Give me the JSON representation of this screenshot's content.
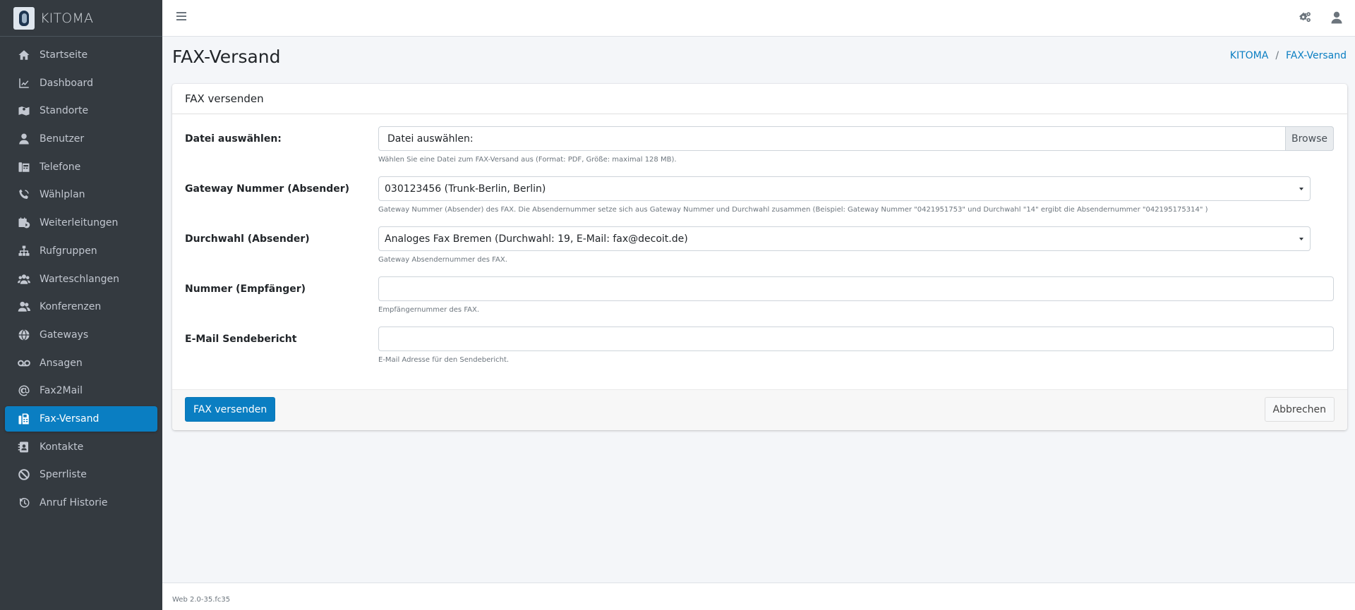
{
  "brand": {
    "name": "KITOMA"
  },
  "sidebar": {
    "items": [
      {
        "label": "Startseite",
        "icon": "home-icon",
        "active": false
      },
      {
        "label": "Dashboard",
        "icon": "chart-line-icon",
        "active": false
      },
      {
        "label": "Standorte",
        "icon": "map-location-icon",
        "active": false
      },
      {
        "label": "Benutzer",
        "icon": "user-icon",
        "active": false
      },
      {
        "label": "Telefone",
        "icon": "fax-phone-icon",
        "active": false
      },
      {
        "label": "Wählplan",
        "icon": "phone-volume-icon",
        "active": false
      },
      {
        "label": "Weiterleitungen",
        "icon": "calendar-forward-icon",
        "active": false
      },
      {
        "label": "Rufgruppen",
        "icon": "sitemap-icon",
        "active": false
      },
      {
        "label": "Warteschlangen",
        "icon": "users-queue-icon",
        "active": false
      },
      {
        "label": "Konferenzen",
        "icon": "user-group-icon",
        "active": false
      },
      {
        "label": "Gateways",
        "icon": "globe-icon",
        "active": false
      },
      {
        "label": "Ansagen",
        "icon": "voicemail-icon",
        "active": false
      },
      {
        "label": "Fax2Mail",
        "icon": "at-icon",
        "active": false
      },
      {
        "label": "Fax-Versand",
        "icon": "fax-icon",
        "active": true
      },
      {
        "label": "Kontakte",
        "icon": "address-book-icon",
        "active": false
      },
      {
        "label": "Sperrliste",
        "icon": "ban-icon",
        "active": false
      },
      {
        "label": "Anruf Historie",
        "icon": "history-icon",
        "active": false
      }
    ]
  },
  "header": {
    "title": "FAX-Versand",
    "breadcrumb": [
      "KITOMA",
      "FAX-Versand"
    ],
    "separator": "/"
  },
  "card": {
    "title": "FAX versenden",
    "fields": {
      "file": {
        "label": "Datei auswählen:",
        "placeholder": "Datei auswählen:",
        "browse": "Browse",
        "help": "Wählen Sie eine Datei zum FAX-Versand aus (Format: PDF, Größe: maximal 128 MB)."
      },
      "gateway": {
        "label": "Gateway Nummer (Absender)",
        "value": "030123456 (Trunk-Berlin, Berlin)",
        "help": "Gateway Nummer (Absender) des FAX. Die Absendernummer setze sich aus Gateway Nummer und Durchwahl zusammen (Beispiel: Gateway Nummer \"0421951753\" und Durchwahl \"14\" ergibt die Absendernummer \"042195175314\" )"
      },
      "extension": {
        "label": "Durchwahl (Absender)",
        "value": "Analoges Fax Bremen (Durchwahl: 19, E-Mail: fax@decoit.de)",
        "help": "Gateway Absendernummer des FAX."
      },
      "recipient": {
        "label": "Nummer (Empfänger)",
        "value": "",
        "help": "Empfängernummer des FAX."
      },
      "email": {
        "label": "E-Mail Sendebericht",
        "value": "",
        "help": "E-Mail Adresse für den Sendebericht."
      }
    },
    "submit": "FAX versenden",
    "cancel": "Abbrechen"
  },
  "footer": {
    "version": "Web 2.0-35.fc35"
  },
  "colors": {
    "sidebar": "#343a40",
    "accent": "#0a7ec2",
    "background": "#f4f6f9"
  }
}
